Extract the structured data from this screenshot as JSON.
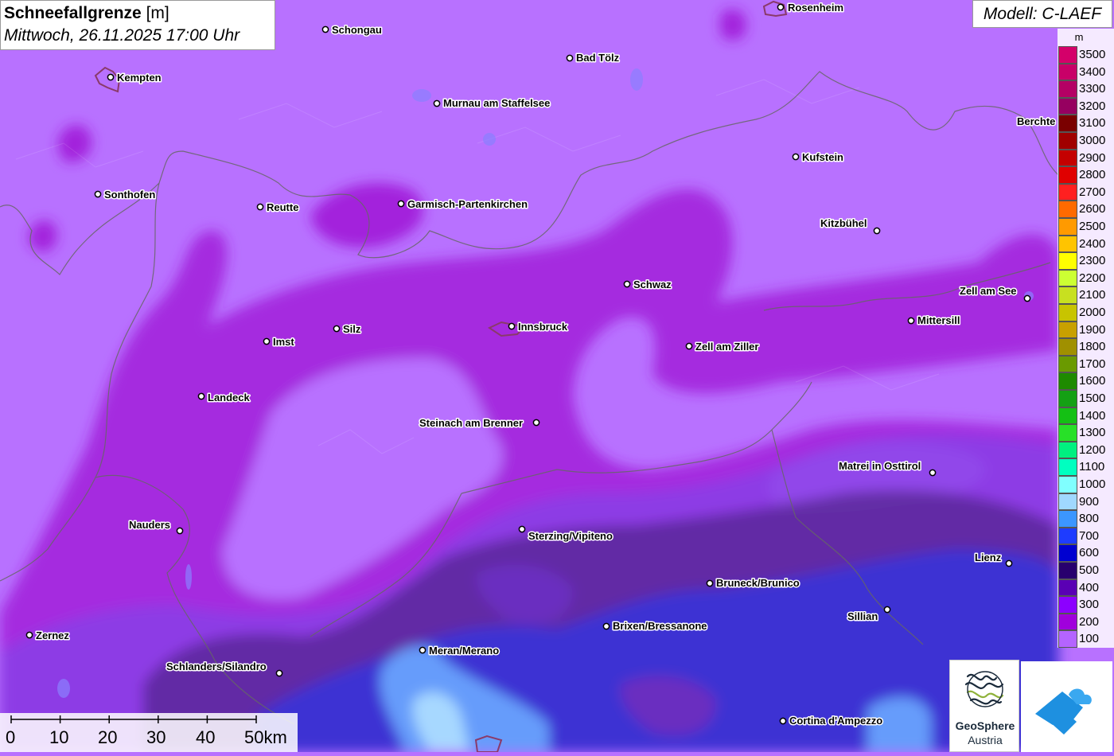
{
  "title": {
    "main": "Schneefallgrenze",
    "unit": "[m]",
    "date": "Mittwoch, 26.11.2025 17:00 Uhr"
  },
  "model": "Modell: C-LAEF",
  "legend": {
    "unit": "m",
    "items": [
      {
        "value": "3500",
        "color": "#d4006a"
      },
      {
        "value": "3400",
        "color": "#c80068"
      },
      {
        "value": "3300",
        "color": "#b40064"
      },
      {
        "value": "3200",
        "color": "#960060"
      },
      {
        "value": "3100",
        "color": "#7a0000"
      },
      {
        "value": "3000",
        "color": "#a00000"
      },
      {
        "value": "2900",
        "color": "#c40000"
      },
      {
        "value": "2800",
        "color": "#e00000"
      },
      {
        "value": "2700",
        "color": "#ff2020"
      },
      {
        "value": "2600",
        "color": "#ff6a00"
      },
      {
        "value": "2500",
        "color": "#ff9a00"
      },
      {
        "value": "2400",
        "color": "#ffc400"
      },
      {
        "value": "2300",
        "color": "#ffff00"
      },
      {
        "value": "2200",
        "color": "#ccff33"
      },
      {
        "value": "2100",
        "color": "#c8e020"
      },
      {
        "value": "2000",
        "color": "#c8c400"
      },
      {
        "value": "1900",
        "color": "#c8a000"
      },
      {
        "value": "1800",
        "color": "#a09000"
      },
      {
        "value": "1700",
        "color": "#6a9a00"
      },
      {
        "value": "1600",
        "color": "#1e8a00"
      },
      {
        "value": "1500",
        "color": "#14a014"
      },
      {
        "value": "1400",
        "color": "#14c014"
      },
      {
        "value": "1300",
        "color": "#28e028"
      },
      {
        "value": "1200",
        "color": "#00f080"
      },
      {
        "value": "1100",
        "color": "#00ffc0"
      },
      {
        "value": "1000",
        "color": "#80ffff"
      },
      {
        "value": "900",
        "color": "#a0d8ff"
      },
      {
        "value": "800",
        "color": "#3c96ff"
      },
      {
        "value": "700",
        "color": "#1e3cff"
      },
      {
        "value": "600",
        "color": "#0000d0"
      },
      {
        "value": "500",
        "color": "#28006e"
      },
      {
        "value": "400",
        "color": "#5a00b4"
      },
      {
        "value": "300",
        "color": "#8c00ff"
      },
      {
        "value": "200",
        "color": "#a000dc"
      },
      {
        "value": "100",
        "color": "#b464ff"
      }
    ]
  },
  "cities": [
    "Rosenheim",
    "Schongau",
    "Kempten",
    "Bad Tölz",
    "Murnau am Staffelsee",
    "Berchte",
    "Kufstein",
    "Sonthofen",
    "Reutte",
    "Garmisch-Partenkirchen",
    "Kitzbühel",
    "Zell am See",
    "Schwaz",
    "Mittersill",
    "Innsbruck",
    "Silz",
    "Imst",
    "Zell am Ziller",
    "Landeck",
    "Steinach am Brenner",
    "Matrei in Osttirol",
    "Nauders",
    "Sterzing/Vipiteno",
    "Lienz",
    "Bruneck/Brunico",
    "Sillian",
    "Brixen/Bressanone",
    "Zernez",
    "Meran/Merano",
    "Schlanders/Silandro",
    "Cortina d'Ampezzo"
  ],
  "scale": {
    "labels": [
      "0",
      "10",
      "20",
      "30",
      "40",
      "50km"
    ]
  },
  "logos": {
    "geosphere_1": "GeoSphere",
    "geosphere_2": "Austria"
  }
}
